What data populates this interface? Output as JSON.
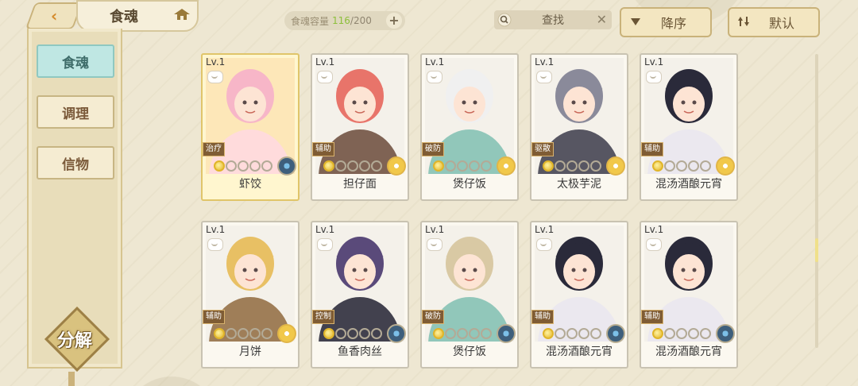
{
  "header": {
    "title": "食魂",
    "capacity_label": "食魂容量",
    "capacity_current": "116",
    "capacity_total": "/200",
    "capacity_add": "+",
    "search_placeholder": "查找",
    "search_clear": "✕",
    "sort_label": "降序",
    "default_label": "默认"
  },
  "sidebar": {
    "items": [
      {
        "label": "食魂",
        "active": true
      },
      {
        "label": "调理",
        "active": false
      },
      {
        "label": "信物",
        "active": false
      }
    ],
    "decompose_label": "分解"
  },
  "cards": [
    {
      "level": "Lv.1",
      "role": "治疗",
      "name": "虾饺",
      "medal": "blue",
      "highlight": true,
      "palette": [
        "#f7b6c8",
        "#ffd8e2"
      ]
    },
    {
      "level": "Lv.1",
      "role": "辅助",
      "name": "担仔面",
      "medal": "yellow",
      "highlight": false,
      "palette": [
        "#e8746a",
        "#6a4a3a"
      ]
    },
    {
      "level": "Lv.1",
      "role": "破防",
      "name": "煲仔饭",
      "medal": "yellow",
      "highlight": false,
      "palette": [
        "#f0f0f0",
        "#7fbfb2"
      ]
    },
    {
      "level": "Lv.1",
      "role": "驱散",
      "name": "太极芋泥",
      "medal": "yellow",
      "highlight": false,
      "palette": [
        "#8a8a9a",
        "#3b3b4a"
      ]
    },
    {
      "level": "Lv.1",
      "role": "辅助",
      "name": "混汤酒酿元宵",
      "medal": "yellow",
      "highlight": false,
      "palette": [
        "#2a2a3a",
        "#e9e6f0"
      ]
    },
    {
      "level": "Lv.1",
      "role": "辅助",
      "name": "月饼",
      "medal": "yellow",
      "highlight": false,
      "palette": [
        "#e8c064",
        "#8f6a3e"
      ]
    },
    {
      "level": "Lv.1",
      "role": "控制",
      "name": "鱼香肉丝",
      "medal": "blue",
      "highlight": false,
      "palette": [
        "#5a4a7a",
        "#222233"
      ]
    },
    {
      "level": "Lv.1",
      "role": "破防",
      "name": "煲仔饭",
      "medal": "blue",
      "highlight": false,
      "palette": [
        "#d9c9a4",
        "#7fbfb2"
      ]
    },
    {
      "level": "Lv.1",
      "role": "辅助",
      "name": "混汤酒酿元宵",
      "medal": "blue",
      "highlight": false,
      "palette": [
        "#2a2a3a",
        "#e9e6f0"
      ]
    },
    {
      "level": "Lv.1",
      "role": "辅助",
      "name": "混汤酒酿元宵",
      "medal": "blue",
      "highlight": false,
      "palette": [
        "#2a2a3a",
        "#e9e6f0"
      ]
    }
  ],
  "stars_filled": 1,
  "stars_total": 5
}
